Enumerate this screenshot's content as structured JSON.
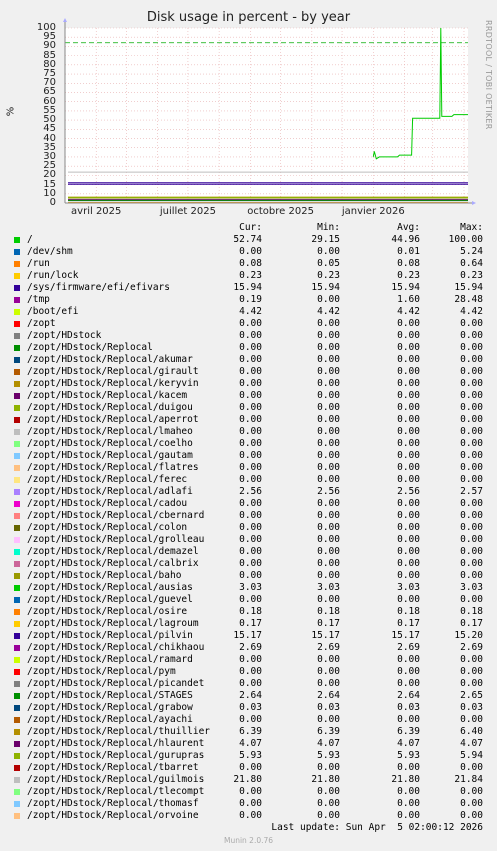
{
  "chart_data": {
    "type": "line",
    "title": "Disk usage in percent - by year",
    "ylabel": "%",
    "side_label": "RRDTOOL / TOBI OETIKER",
    "ylim": [
      0,
      100
    ],
    "yticks": [
      "0",
      "10",
      "15",
      "20",
      "25",
      "30",
      "35",
      "40",
      "45",
      "50",
      "55",
      "60",
      "65",
      "70",
      "75",
      "80",
      "85",
      "90",
      "95",
      "100"
    ],
    "ytick_values": [
      0,
      10,
      15,
      20,
      25,
      30,
      35,
      40,
      45,
      50,
      55,
      60,
      65,
      70,
      75,
      80,
      85,
      90,
      95,
      100
    ],
    "xticks": [
      {
        "label": "avril 2025",
        "date": "2025-04-01"
      },
      {
        "label": "juillet 2025",
        "date": "2025-07-01"
      },
      {
        "label": "octobre 2025",
        "date": "2025-10-01"
      },
      {
        "label": "janvier 2026",
        "date": "2026-01-01"
      }
    ],
    "xlim": [
      "2025-03-01",
      "2026-04-05"
    ],
    "warning_level": 92,
    "grid": true,
    "columns": [
      "Cur:",
      "Min:",
      "Avg:",
      "Max:"
    ],
    "series": [
      {
        "name": "/",
        "color": "#00cc00",
        "cur": "52.74",
        "min": "29.15",
        "avg": "44.96",
        "max": "100.00",
        "line": [
          [
            "2026-01-01",
            30
          ],
          [
            "2026-01-02",
            33
          ],
          [
            "2026-01-04",
            29
          ],
          [
            "2026-01-07",
            30
          ],
          [
            "2026-01-15",
            30
          ],
          [
            "2026-01-25",
            30
          ],
          [
            "2026-01-27",
            31
          ],
          [
            "2026-02-08",
            31
          ],
          [
            "2026-02-09",
            51
          ],
          [
            "2026-02-15",
            51
          ],
          [
            "2026-02-25",
            51
          ],
          [
            "2026-03-08",
            51
          ],
          [
            "2026-03-09",
            100
          ],
          [
            "2026-03-10",
            52
          ],
          [
            "2026-03-20",
            52
          ],
          [
            "2026-03-22",
            53
          ],
          [
            "2026-04-05",
            53
          ]
        ]
      },
      {
        "name": "/dev/shm",
        "color": "#0066b3",
        "cur": "0.00",
        "min": "0.00",
        "avg": "0.01",
        "max": "5.24"
      },
      {
        "name": "/run",
        "color": "#ff8000",
        "cur": "0.08",
        "min": "0.05",
        "avg": "0.08",
        "max": "0.64"
      },
      {
        "name": "/run/lock",
        "color": "#ffcc00",
        "cur": "0.23",
        "min": "0.23",
        "avg": "0.23",
        "max": "0.23"
      },
      {
        "name": "/sys/firmware/efi/efivars",
        "color": "#330099",
        "cur": "15.94",
        "min": "15.94",
        "avg": "15.94",
        "max": "15.94"
      },
      {
        "name": "/tmp",
        "color": "#990099",
        "cur": "0.19",
        "min": "0.00",
        "avg": "1.60",
        "max": "28.48"
      },
      {
        "name": "/boot/efi",
        "color": "#ccff00",
        "cur": "4.42",
        "min": "4.42",
        "avg": "4.42",
        "max": "4.42"
      },
      {
        "name": "/zopt",
        "color": "#ff0000",
        "cur": "0.00",
        "min": "0.00",
        "avg": "0.00",
        "max": "0.00"
      },
      {
        "name": "/zopt/HDstock",
        "color": "#808080",
        "cur": "0.00",
        "min": "0.00",
        "avg": "0.00",
        "max": "0.00"
      },
      {
        "name": "/zopt/HDstock/Replocal",
        "color": "#008f00",
        "cur": "0.00",
        "min": "0.00",
        "avg": "0.00",
        "max": "0.00"
      },
      {
        "name": "/zopt/HDstock/Replocal/akumar",
        "color": "#00487d",
        "cur": "0.00",
        "min": "0.00",
        "avg": "0.00",
        "max": "0.00"
      },
      {
        "name": "/zopt/HDstock/Replocal/girault",
        "color": "#b35a00",
        "cur": "0.00",
        "min": "0.00",
        "avg": "0.00",
        "max": "0.00"
      },
      {
        "name": "/zopt/HDstock/Replocal/keryvin",
        "color": "#b38f00",
        "cur": "0.00",
        "min": "0.00",
        "avg": "0.00",
        "max": "0.00"
      },
      {
        "name": "/zopt/HDstock/Replocal/kacem",
        "color": "#6b006b",
        "cur": "0.00",
        "min": "0.00",
        "avg": "0.00",
        "max": "0.00"
      },
      {
        "name": "/zopt/HDstock/Replocal/duigou",
        "color": "#8fb300",
        "cur": "0.00",
        "min": "0.00",
        "avg": "0.00",
        "max": "0.00"
      },
      {
        "name": "/zopt/HDstock/Replocal/aperrot",
        "color": "#b30000",
        "cur": "0.00",
        "min": "0.00",
        "avg": "0.00",
        "max": "0.00"
      },
      {
        "name": "/zopt/HDstock/Replocal/lmaheo",
        "color": "#bebebe",
        "cur": "0.00",
        "min": "0.00",
        "avg": "0.00",
        "max": "0.00"
      },
      {
        "name": "/zopt/HDstock/Replocal/coelho",
        "color": "#80ff80",
        "cur": "0.00",
        "min": "0.00",
        "avg": "0.00",
        "max": "0.00"
      },
      {
        "name": "/zopt/HDstock/Replocal/gautam",
        "color": "#80c9ff",
        "cur": "0.00",
        "min": "0.00",
        "avg": "0.00",
        "max": "0.00"
      },
      {
        "name": "/zopt/HDstock/Replocal/flatres",
        "color": "#ffc080",
        "cur": "0.00",
        "min": "0.00",
        "avg": "0.00",
        "max": "0.00"
      },
      {
        "name": "/zopt/HDstock/Replocal/ferec",
        "color": "#ffe680",
        "cur": "0.00",
        "min": "0.00",
        "avg": "0.00",
        "max": "0.00"
      },
      {
        "name": "/zopt/HDstock/Replocal/adlafi",
        "color": "#aa80ff",
        "cur": "2.56",
        "min": "2.56",
        "avg": "2.56",
        "max": "2.57"
      },
      {
        "name": "/zopt/HDstock/Replocal/cadou",
        "color": "#ee00cc",
        "cur": "0.00",
        "min": "0.00",
        "avg": "0.00",
        "max": "0.00"
      },
      {
        "name": "/zopt/HDstock/Replocal/cbernard",
        "color": "#ff8080",
        "cur": "0.00",
        "min": "0.00",
        "avg": "0.00",
        "max": "0.00"
      },
      {
        "name": "/zopt/HDstock/Replocal/colon",
        "color": "#666600",
        "cur": "0.00",
        "min": "0.00",
        "avg": "0.00",
        "max": "0.00"
      },
      {
        "name": "/zopt/HDstock/Replocal/grolleau",
        "color": "#ffbfff",
        "cur": "0.00",
        "min": "0.00",
        "avg": "0.00",
        "max": "0.00"
      },
      {
        "name": "/zopt/HDstock/Replocal/demazel",
        "color": "#00ffcc",
        "cur": "0.00",
        "min": "0.00",
        "avg": "0.00",
        "max": "0.00"
      },
      {
        "name": "/zopt/HDstock/Replocal/calbrix",
        "color": "#cc6699",
        "cur": "0.00",
        "min": "0.00",
        "avg": "0.00",
        "max": "0.00"
      },
      {
        "name": "/zopt/HDstock/Replocal/baho",
        "color": "#999900",
        "cur": "0.00",
        "min": "0.00",
        "avg": "0.00",
        "max": "0.00"
      },
      {
        "name": "/zopt/HDstock/Replocal/ausias",
        "color": "#00cc00",
        "cur": "3.03",
        "min": "3.03",
        "avg": "3.03",
        "max": "3.03"
      },
      {
        "name": "/zopt/HDstock/Replocal/guevel",
        "color": "#0066b3",
        "cur": "0.00",
        "min": "0.00",
        "avg": "0.00",
        "max": "0.00"
      },
      {
        "name": "/zopt/HDstock/Replocal/osire",
        "color": "#ff8000",
        "cur": "0.18",
        "min": "0.18",
        "avg": "0.18",
        "max": "0.18"
      },
      {
        "name": "/zopt/HDstock/Replocal/lagroum",
        "color": "#ffcc00",
        "cur": "0.17",
        "min": "0.17",
        "avg": "0.17",
        "max": "0.17"
      },
      {
        "name": "/zopt/HDstock/Replocal/pilvin",
        "color": "#330099",
        "cur": "15.17",
        "min": "15.17",
        "avg": "15.17",
        "max": "15.20"
      },
      {
        "name": "/zopt/HDstock/Replocal/chikhaou",
        "color": "#990099",
        "cur": "2.69",
        "min": "2.69",
        "avg": "2.69",
        "max": "2.69"
      },
      {
        "name": "/zopt/HDstock/Replocal/ramard",
        "color": "#ccff00",
        "cur": "0.00",
        "min": "0.00",
        "avg": "0.00",
        "max": "0.00"
      },
      {
        "name": "/zopt/HDstock/Replocal/pym",
        "color": "#ff0000",
        "cur": "0.00",
        "min": "0.00",
        "avg": "0.00",
        "max": "0.00"
      },
      {
        "name": "/zopt/HDstock/Replocal/picandet",
        "color": "#808080",
        "cur": "0.00",
        "min": "0.00",
        "avg": "0.00",
        "max": "0.00"
      },
      {
        "name": "/zopt/HDstock/Replocal/STAGES",
        "color": "#008f00",
        "cur": "2.64",
        "min": "2.64",
        "avg": "2.64",
        "max": "2.65"
      },
      {
        "name": "/zopt/HDstock/Replocal/grabow",
        "color": "#00487d",
        "cur": "0.03",
        "min": "0.03",
        "avg": "0.03",
        "max": "0.03"
      },
      {
        "name": "/zopt/HDstock/Replocal/ayachi",
        "color": "#b35a00",
        "cur": "0.00",
        "min": "0.00",
        "avg": "0.00",
        "max": "0.00"
      },
      {
        "name": "/zopt/HDstock/Replocal/thuillier",
        "color": "#b38f00",
        "cur": "6.39",
        "min": "6.39",
        "avg": "6.39",
        "max": "6.40"
      },
      {
        "name": "/zopt/HDstock/Replocal/hlaurent",
        "color": "#6b006b",
        "cur": "4.07",
        "min": "4.07",
        "avg": "4.07",
        "max": "4.07"
      },
      {
        "name": "/zopt/HDstock/Replocal/gurupras",
        "color": "#8fb300",
        "cur": "5.93",
        "min": "5.93",
        "avg": "5.93",
        "max": "5.94"
      },
      {
        "name": "/zopt/HDstock/Replocal/tbarret",
        "color": "#b30000",
        "cur": "0.00",
        "min": "0.00",
        "avg": "0.00",
        "max": "0.00"
      },
      {
        "name": "/zopt/HDstock/Replocal/guilmois",
        "color": "#bebebe",
        "cur": "21.80",
        "min": "21.80",
        "avg": "21.80",
        "max": "21.84"
      },
      {
        "name": "/zopt/HDstock/Replocal/tlecompt",
        "color": "#80ff80",
        "cur": "0.00",
        "min": "0.00",
        "avg": "0.00",
        "max": "0.00"
      },
      {
        "name": "/zopt/HDstock/Replocal/thomasf",
        "color": "#80c9ff",
        "cur": "0.00",
        "min": "0.00",
        "avg": "0.00",
        "max": "0.00"
      },
      {
        "name": "/zopt/HDstock/Replocal/orvoine",
        "color": "#ffc080",
        "cur": "0.00",
        "min": "0.00",
        "avg": "0.00",
        "max": "0.00"
      }
    ]
  },
  "footer": {
    "last_update": "Last update: Sun Apr  5 02:00:12 2026",
    "generator": "Munin 2.0.76"
  }
}
